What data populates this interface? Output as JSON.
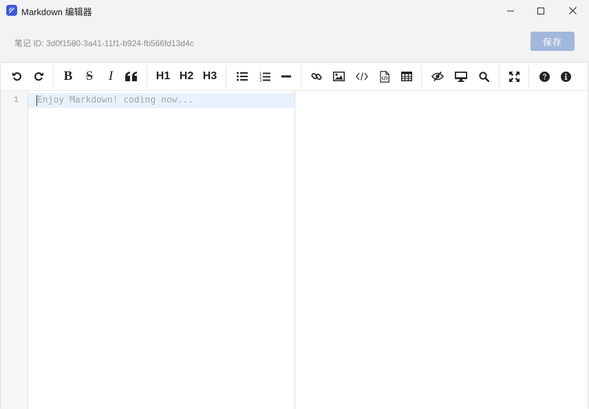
{
  "window": {
    "title": "Markdown 编辑器",
    "controls": [
      "minimize-icon",
      "maximize-icon",
      "close-icon"
    ]
  },
  "header": {
    "note_id_text": "笔记 ID: 3d0f1580-3a41-11f1-b924-fb566fd13d4c",
    "save_label": "保存"
  },
  "toolbar": {
    "groups": [
      [
        "undo-icon",
        "redo-icon"
      ],
      [
        "bold",
        "strikethrough",
        "italic",
        "quote-icon"
      ],
      [
        "H1",
        "H2",
        "H3"
      ],
      [
        "unordered-list-icon",
        "ordered-list-icon",
        "horizontal-rule-icon"
      ],
      [
        "link-icon",
        "image-icon",
        "code-icon",
        "code-block-icon",
        "table-icon"
      ],
      [
        "watch-toggle-icon",
        "preview-icon",
        "search-icon"
      ],
      [
        "fullscreen-icon"
      ],
      [
        "help-icon",
        "info-icon"
      ]
    ],
    "bold_glyph": "B",
    "strike_glyph": "S",
    "italic_glyph": "I",
    "h1": "H1",
    "h2": "H2",
    "h3": "H3"
  },
  "editor": {
    "line_number": "1",
    "placeholder": "Enjoy Markdown! coding now..."
  },
  "colors": {
    "save_button_bg": "#a2b7dc",
    "active_line_bg": "#e8f2ff",
    "app_icon": "#3b5bdb"
  }
}
